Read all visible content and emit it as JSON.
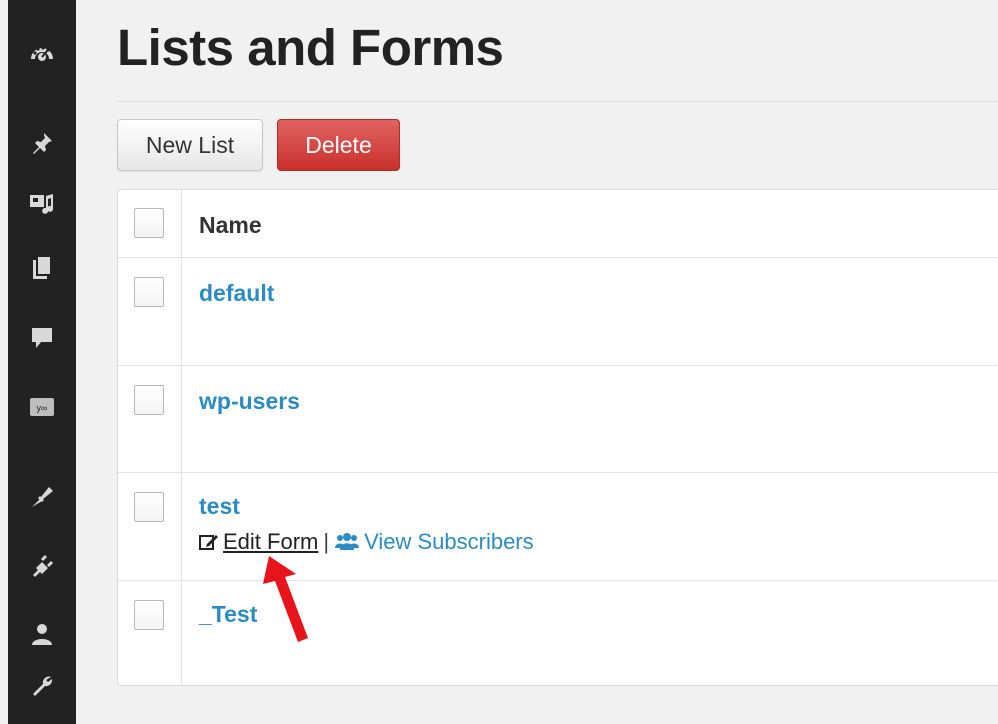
{
  "page": {
    "title": "Lists and Forms"
  },
  "toolbar": {
    "new_list_label": "New List",
    "delete_label": "Delete"
  },
  "table": {
    "header": "Name",
    "rows": [
      {
        "name": "default"
      },
      {
        "name": "wp-users"
      },
      {
        "name": "test",
        "actions": {
          "edit": "Edit Form",
          "separator": "|",
          "view": "View Subscribers"
        }
      },
      {
        "name": "_Test"
      }
    ]
  },
  "sidebar": {
    "icons": [
      "dashboard-icon",
      "pin-icon",
      "media-icon",
      "pages-icon",
      "comments-icon",
      "newsletter-icon",
      "appearance-icon",
      "plugins-icon",
      "users-icon",
      "tools-icon"
    ]
  },
  "colors": {
    "sidebar_bg": "#222222",
    "link": "#2b8cc4",
    "delete_button": "#d9534f",
    "annotation_arrow": "#e8141b"
  }
}
